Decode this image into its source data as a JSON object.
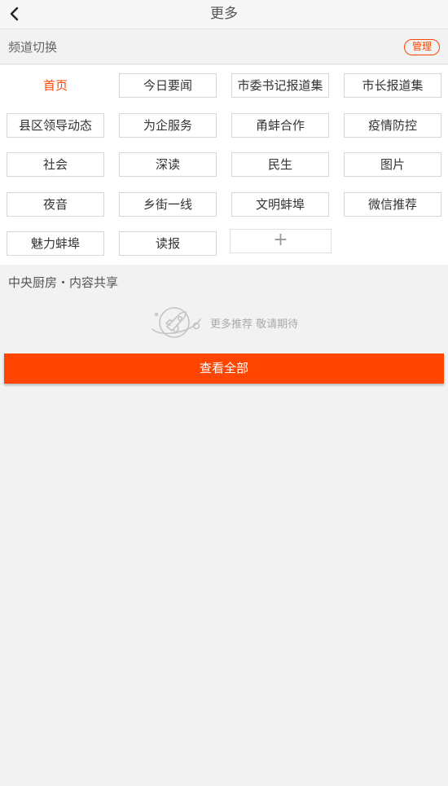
{
  "header": {
    "title": "更多",
    "back_icon": "chevron-left-icon"
  },
  "channel_section": {
    "label": "频道切换",
    "manage_label": "管理",
    "accent_color": "#ff4500",
    "channels": [
      "首页",
      "今日要闻",
      "市委书记报道集",
      "市长报道集",
      "县区领导动态",
      "为企服务",
      "甬蚌合作",
      "疫情防控",
      "社会",
      "深读",
      "民生",
      "图片",
      "夜音",
      "乡街一线",
      "文明蚌埠",
      "微信推荐",
      "魅力蚌埠",
      "读报"
    ],
    "active_channel": "首页",
    "add_icon": "plus-icon",
    "add_glyph": "+"
  },
  "share_section": {
    "title": "中央厨房・内容共享",
    "empty_icon": "rocket-planet-icon",
    "empty_text": "更多推荐 敬请期待",
    "view_all_label": "查看全部"
  }
}
